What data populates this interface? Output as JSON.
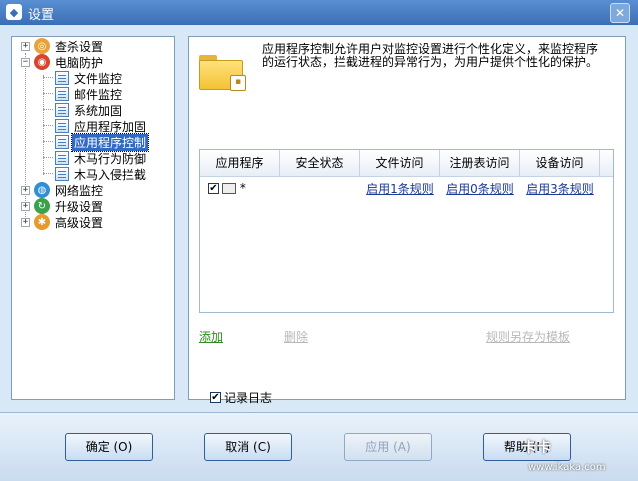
{
  "window": {
    "title": "设置",
    "close_glyph": "✕"
  },
  "tree": {
    "items": [
      {
        "label": "查杀设置",
        "icon": "scan-icon",
        "level": 0,
        "expander": "+"
      },
      {
        "label": "电脑防护",
        "icon": "shield-icon",
        "level": 0,
        "expander": "−"
      },
      {
        "label": "文件监控",
        "icon": "list-doc-icon",
        "level": 1
      },
      {
        "label": "邮件监控",
        "icon": "list-doc-icon",
        "level": 1
      },
      {
        "label": "系统加固",
        "icon": "list-doc-icon",
        "level": 1
      },
      {
        "label": "应用程序加固",
        "icon": "list-doc-icon",
        "level": 1
      },
      {
        "label": "应用程序控制",
        "icon": "list-doc-icon",
        "level": 1,
        "selected": true
      },
      {
        "label": "木马行为防御",
        "icon": "list-doc-icon",
        "level": 1
      },
      {
        "label": "木马入侵拦截",
        "icon": "list-doc-icon",
        "level": 1
      },
      {
        "label": "网络监控",
        "icon": "globe-icon",
        "level": 0,
        "expander": "+"
      },
      {
        "label": "升级设置",
        "icon": "update-icon",
        "level": 0,
        "expander": "+"
      },
      {
        "label": "高级设置",
        "icon": "gear-icon",
        "level": 0,
        "expander": "+"
      }
    ]
  },
  "panel": {
    "description": "应用程序控制允许用户对监控设置进行个性化定义，来监控程序的运行状态，拦截进程的异常行为，为用户提供个性化的保护。",
    "table": {
      "headers": [
        "应用程序",
        "安全状态",
        "文件访问",
        "注册表访问",
        "设备访问"
      ],
      "rows": [
        {
          "checked": "✔",
          "name": "*",
          "status": "",
          "file": "启用1条规则",
          "registry": "启用0条规则",
          "device": "启用3条规则"
        }
      ]
    },
    "add_label": "添加",
    "delete_label": "删除",
    "save_template_label": "规则另存为模板",
    "log_label": "记录日志",
    "log_checked": "✔"
  },
  "footer": {
    "ok": "确定 (O)",
    "cancel": "取消 (C)",
    "apply": "应用 (A)",
    "help": "帮助 (H)"
  },
  "watermark": {
    "text": "卡卡",
    "url": "www.ikaka.com"
  },
  "colors": {
    "accent": "#316ac5",
    "titlebar": "#3b6fb5",
    "add_link": "#2e8a1e",
    "disabled": "#b8b8b8"
  }
}
